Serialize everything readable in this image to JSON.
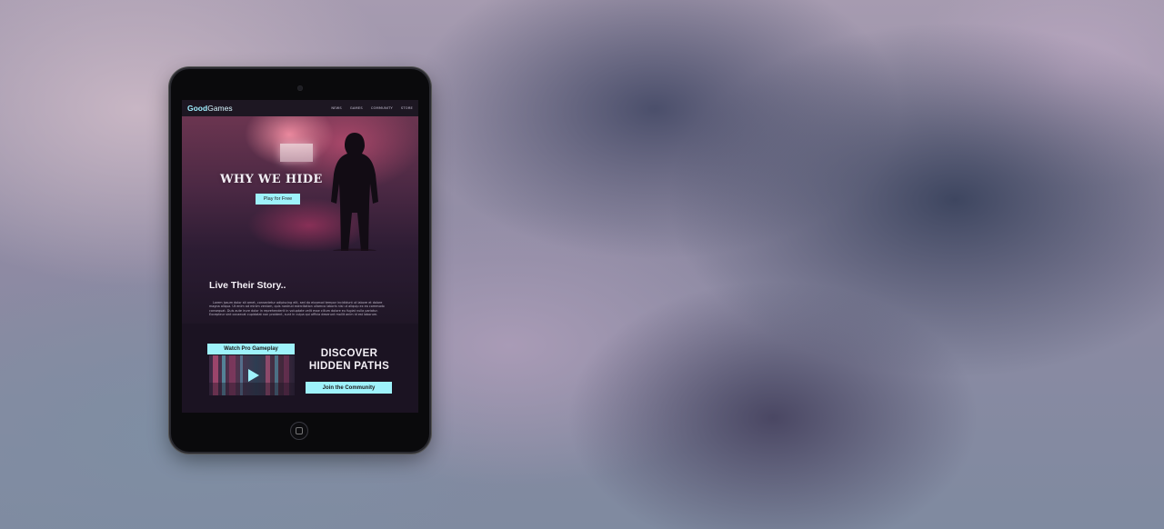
{
  "site": {
    "logo_bold": "Good",
    "logo_rest": "Games",
    "nav": [
      "NEWS",
      "GAMES",
      "COMMUNITY",
      "STORE"
    ]
  },
  "hero": {
    "title": "WHY WE HIDE",
    "cta_label": "Play for Free"
  },
  "story": {
    "title": "Live Their Story..",
    "body": "Lorem ipsum dolor sit amet, consectetur adipiscing elit, sed do eiusmod tempor incididunt ut labore et dolore magna aliqua. Ut enim ad minim veniam, quis nostrud exercitation ullamco laboris nisi ut aliquip ex ea commodo consequat. Duis aute irure dolor in reprehenderit in voluptate velit esse cillum dolore eu fugiat nulla pariatur. Excepteur sint occaecat cupidatat non proident, sunt in culpa qui officia deserunt mollit anim id est laborum."
  },
  "lower": {
    "watch_label": "Watch Pro Gameplay",
    "discover_line1": "DISCOVER",
    "discover_line2": "HIDDEN PATHS",
    "community_label": "Join the Community"
  },
  "colors": {
    "accent": "#9ef2fb",
    "screen_bg": "#1c1524"
  },
  "icons": {
    "video_play": "play-icon"
  }
}
